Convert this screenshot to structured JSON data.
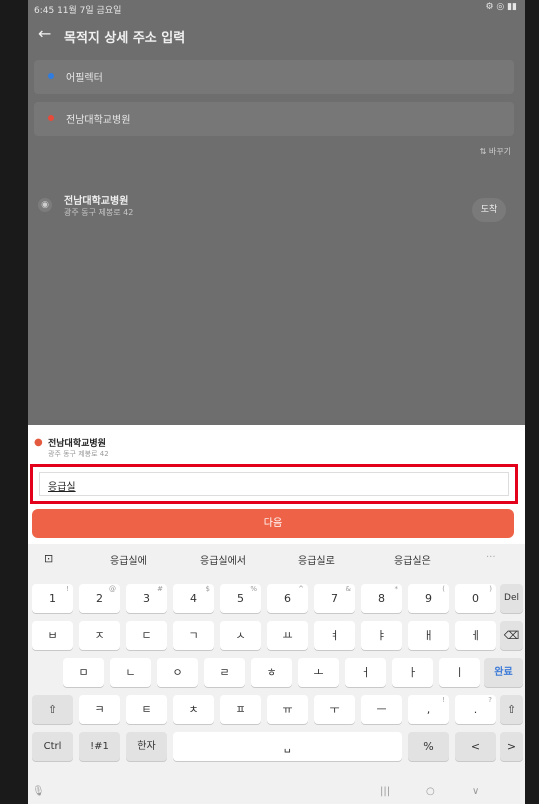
{
  "status": {
    "time": "6:45  11월 7일 금요일",
    "icons": "⚙ ◎ ▮▮"
  },
  "appbar": {
    "title": "목적지 상세 주소 입력"
  },
  "route": {
    "origin": "어필렉터",
    "destination": "전남대학교병원",
    "swap": "⇅ 바꾸기"
  },
  "place": {
    "name": "전남대학교병원",
    "address": "광주 동구 제봉로 42",
    "arrive_label": "도착"
  },
  "selected": {
    "name": "전남대학교병원",
    "address": "광주 동구 제봉로 42"
  },
  "input": {
    "value": "응급실"
  },
  "next_button": "다음",
  "suggestions": [
    "응급실에",
    "응급실에서",
    "응급실로",
    "응급실은"
  ],
  "keyboard": {
    "row1": [
      {
        "k": "1",
        "s": "!"
      },
      {
        "k": "2",
        "s": "@"
      },
      {
        "k": "3",
        "s": "#"
      },
      {
        "k": "4",
        "s": "$"
      },
      {
        "k": "5",
        "s": "%"
      },
      {
        "k": "6",
        "s": "^"
      },
      {
        "k": "7",
        "s": "&"
      },
      {
        "k": "8",
        "s": "*"
      },
      {
        "k": "9",
        "s": "("
      },
      {
        "k": "0",
        "s": ")"
      }
    ],
    "row2": [
      "ㅂ",
      "ㅈ",
      "ㄷ",
      "ㄱ",
      "ㅅ",
      "ㅛ",
      "ㅕ",
      "ㅑ",
      "ㅐ",
      "ㅔ"
    ],
    "row3": [
      "ㅁ",
      "ㄴ",
      "ㅇ",
      "ㄹ",
      "ㅎ",
      "ㅗ",
      "ㅓ",
      "ㅏ",
      "ㅣ"
    ],
    "row4": [
      "ㅋ",
      "ㅌ",
      "ㅊ",
      "ㅍ",
      "ㅠ",
      "ㅜ",
      "ㅡ"
    ],
    "del": "Del",
    "done": "완료",
    "ctrl": "Ctrl",
    "sym": "!#1",
    "hanja": "한자",
    "comma": ",",
    "comma_sup": "!",
    "period": ".",
    "period_sup": "?",
    "slash": "%",
    "left": "<",
    "right": ">"
  },
  "accent": "#ee6347"
}
